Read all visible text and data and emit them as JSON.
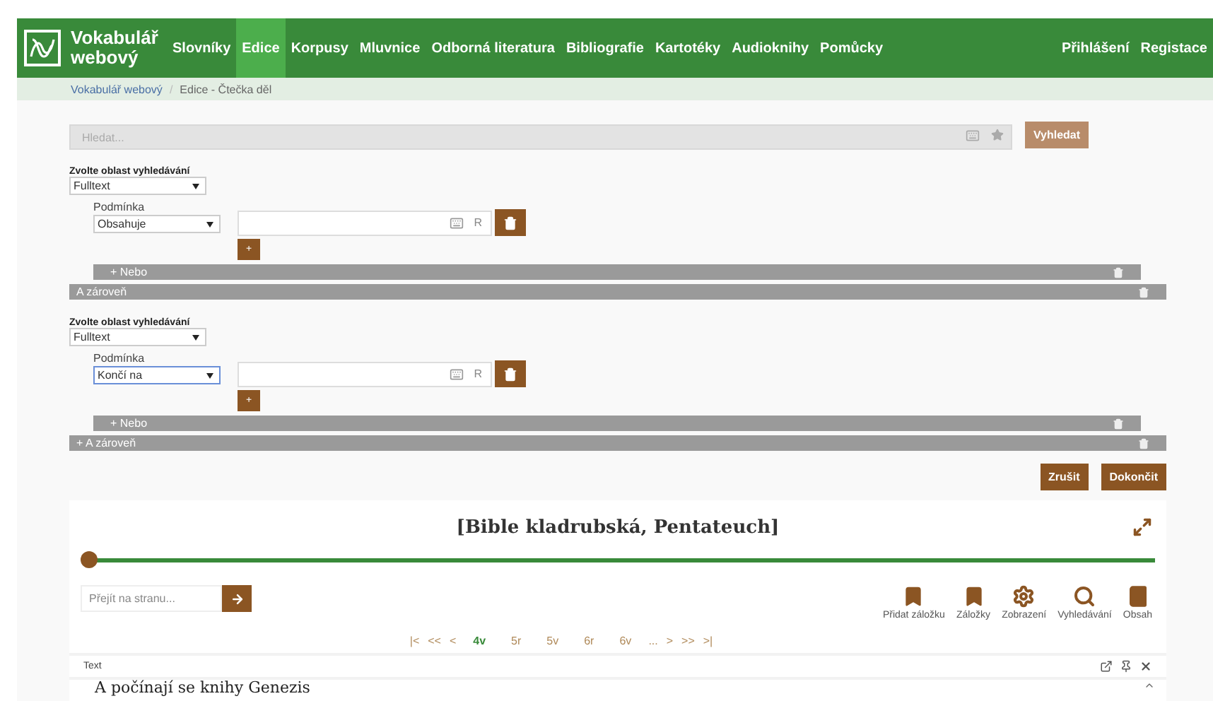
{
  "header": {
    "logo_title": "Vokabulář webový",
    "nav": [
      {
        "label": "Slovníky",
        "selected": false
      },
      {
        "label": "Edice",
        "selected": true
      },
      {
        "label": "Korpusy",
        "selected": false
      },
      {
        "label": "Mluvnice",
        "selected": false
      },
      {
        "label": "Odborná literatura",
        "selected": false
      },
      {
        "label": "Bibliografie",
        "selected": false
      },
      {
        "label": "Kartotéky",
        "selected": false
      },
      {
        "label": "Audioknihy",
        "selected": false
      },
      {
        "label": "Pomůcky",
        "selected": false
      }
    ],
    "account": [
      "Přihlášení",
      "Registace"
    ]
  },
  "breadcrumb": {
    "items": [
      "Vokabulář webový",
      "Edice - Čtečka děl"
    ],
    "separator": "/"
  },
  "search": {
    "placeholder": "Hledat...",
    "button": "Vyhledat"
  },
  "criteria": [
    {
      "area_label": "Zvolte oblast vyhledávání",
      "area": "Fulltext",
      "condition_label": "Podmínka",
      "condition": "Obsahuje",
      "condition_focused": false,
      "r_label": "R",
      "plus": "+",
      "or_button": "+ Nebo",
      "and_button": "A zároveň"
    },
    {
      "area_label": "Zvolte oblast vyhledávání",
      "area": "Fulltext",
      "condition_label": "Podmínka",
      "condition": "Končí na",
      "condition_focused": true,
      "r_label": "R",
      "plus": "+",
      "or_button": "+ Nebo",
      "and_button": "+ A zároveň"
    }
  ],
  "actions": [
    "Zrušit",
    "Dokončit"
  ],
  "reader": {
    "title": "[Bible kladrubská, Pentateuch]",
    "slider": {
      "level": 0
    },
    "goto_placeholder": "Přejít na stranu...",
    "tools": [
      {
        "kind": "bookmark",
        "label": "Přidat záložku"
      },
      {
        "kind": "bookmark",
        "label": "Záložky"
      },
      {
        "kind": "gear",
        "label": "Zobrazení"
      },
      {
        "kind": "search",
        "label": "Vyhledávání"
      },
      {
        "kind": "book",
        "label": "Obsah"
      }
    ],
    "pager_start": [
      "|<",
      "<<",
      "<"
    ],
    "pages": [
      {
        "label": "4v",
        "selected": true
      },
      {
        "label": "5r",
        "selected": false
      },
      {
        "label": "5v",
        "selected": false
      },
      {
        "label": "6r",
        "selected": false
      },
      {
        "label": "6v",
        "selected": false
      }
    ],
    "pager_end": [
      "...",
      ">",
      ">>",
      ">|"
    ],
    "panel_title": "Text",
    "first_line": "A počínají se knihy Genezis"
  }
}
